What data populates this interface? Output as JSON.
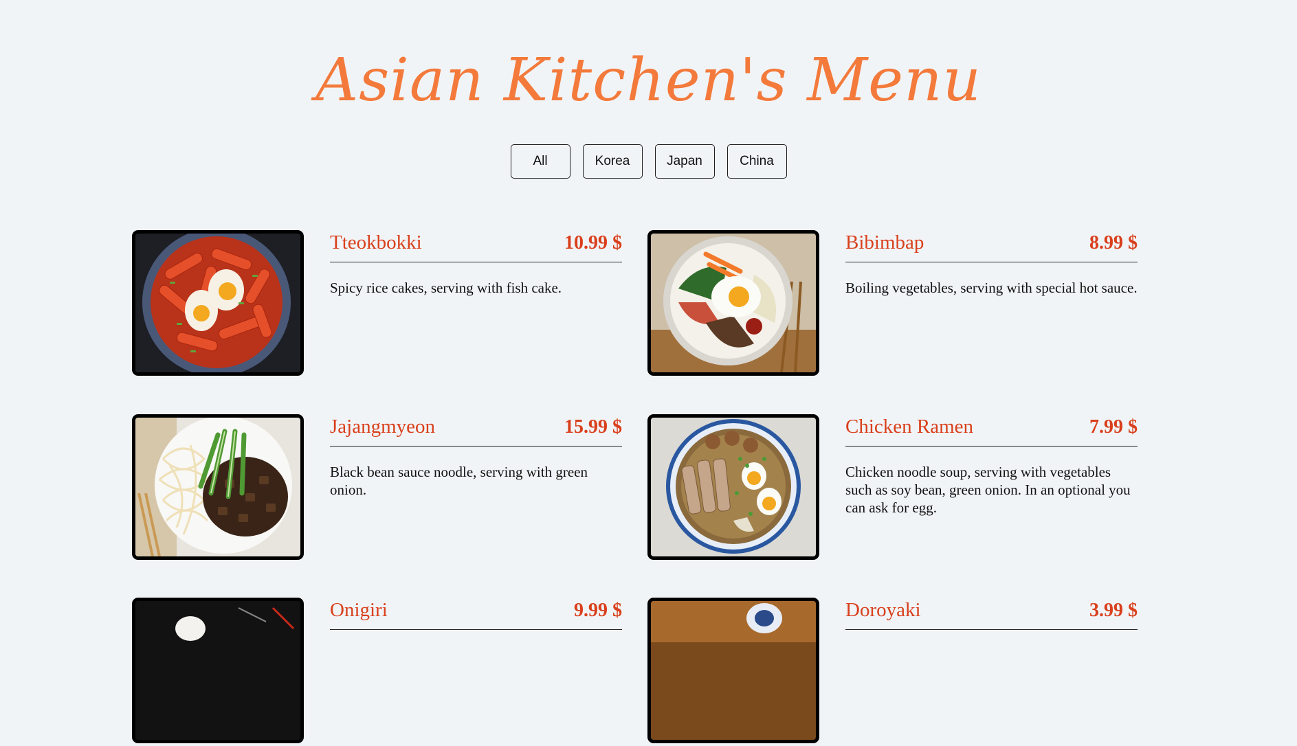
{
  "page": {
    "title": "Asian Kitchen's Menu"
  },
  "filters": [
    {
      "label": "All"
    },
    {
      "label": "Korea"
    },
    {
      "label": "Japan"
    },
    {
      "label": "China"
    }
  ],
  "menu": [
    {
      "name": "Tteokbokki",
      "price": "10.99 $",
      "desc": "Spicy rice cakes, serving with fish cake.",
      "image": "tteokbokki-photo"
    },
    {
      "name": "Bibimbap",
      "price": "8.99 $",
      "desc": "Boiling vegetables, serving with special hot sauce.",
      "image": "bibimbap-photo"
    },
    {
      "name": "Jajangmyeon",
      "price": "15.99 $",
      "desc": "Black bean sauce noodle, serving with green onion.",
      "image": "jajangmyeon-photo"
    },
    {
      "name": "Chicken Ramen",
      "price": "7.99 $",
      "desc": "Chicken noodle soup, serving with vegetables such as soy bean, green onion. In an optional you can ask for egg.",
      "image": "ramen-photo"
    },
    {
      "name": "Onigiri",
      "price": "9.99 $",
      "desc": "",
      "image": "onigiri-photo"
    },
    {
      "name": "Doroyaki",
      "price": "3.99 $",
      "desc": "",
      "image": "doroyaki-photo"
    }
  ],
  "colors": {
    "background": "#f1f4f7",
    "title": "#f37a3b",
    "accent": "#d9401c",
    "text": "#111111"
  }
}
